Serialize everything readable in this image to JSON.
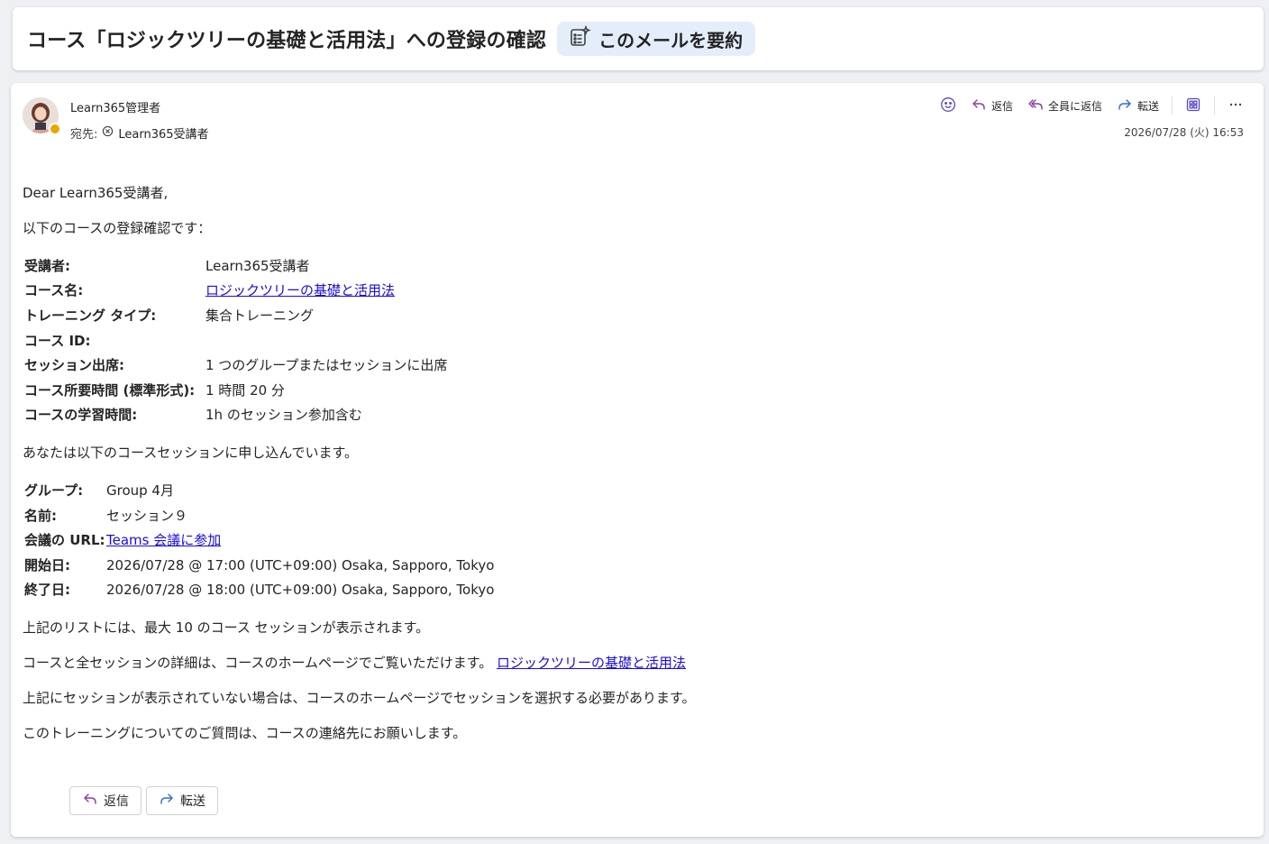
{
  "subject": {
    "title": "コース「ロジックツリーの基礎と活用法」への登録の確認",
    "summarize_label": "このメールを要約"
  },
  "header": {
    "sender": "Learn365管理者",
    "to_label": "宛先:",
    "to_name": "Learn365受講者",
    "timestamp": "2026/07/28 (火) 16:53",
    "actions": {
      "reply": "返信",
      "reply_all": "全員に返信",
      "forward": "転送"
    }
  },
  "body": {
    "greeting": "Dear Learn365受講者,",
    "intro": "以下のコースの登録確認です：",
    "course_details": [
      {
        "key": "受講者:",
        "value": "Learn365受講者"
      },
      {
        "key": "コース名:",
        "value": "ロジックツリーの基礎と活用法"
      },
      {
        "key": "トレーニング タイプ:",
        "value": "集合トレーニング"
      },
      {
        "key": "コース ID:",
        "value": ""
      },
      {
        "key": "セッション出席:",
        "value": "1 つのグループまたはセッションに出席"
      },
      {
        "key": "コース所要時間 (標準形式):",
        "value": "1 時間 20 分"
      },
      {
        "key": "コースの学習時間:",
        "value": "1h のセッション参加含む"
      }
    ],
    "session_intro": "あなたは以下のコースセッションに申し込んでいます。",
    "session_details": [
      {
        "key": "グループ:",
        "value": "Group 4月"
      },
      {
        "key": "名前:",
        "value": "セッション９"
      },
      {
        "key": "会議の URL:",
        "value": "Teams 会議に参加"
      },
      {
        "key": "開始日:",
        "value": "2026/07/28 @ 17:00 (UTC+09:00) Osaka, Sapporo, Tokyo"
      },
      {
        "key": "終了日:",
        "value": "2026/07/28 @ 18:00 (UTC+09:00) Osaka, Sapporo, Tokyo"
      }
    ],
    "list_note": "上記のリストには、最大 10 のコース セッションが表示されます。",
    "details_text": "コースと全セッションの詳細は、コースのホームページでご覧いただけます。",
    "details_link": "ロジックツリーの基礎と活用法",
    "select_note": "上記にセッションが表示されていない場合は、コースのホームページでセッションを選択する必要があります。",
    "contact_note": "このトレーニングについてのご質問は、コースの連絡先にお願いします。"
  },
  "footer": {
    "reply": "返信",
    "forward": "転送"
  },
  "colors": {
    "link": "#1a0dde",
    "reply_icon": "#8a3ea6",
    "forward_icon": "#2f6fd6",
    "summarize_bg": "#e4eefb",
    "presence_away": "#e8a800"
  }
}
